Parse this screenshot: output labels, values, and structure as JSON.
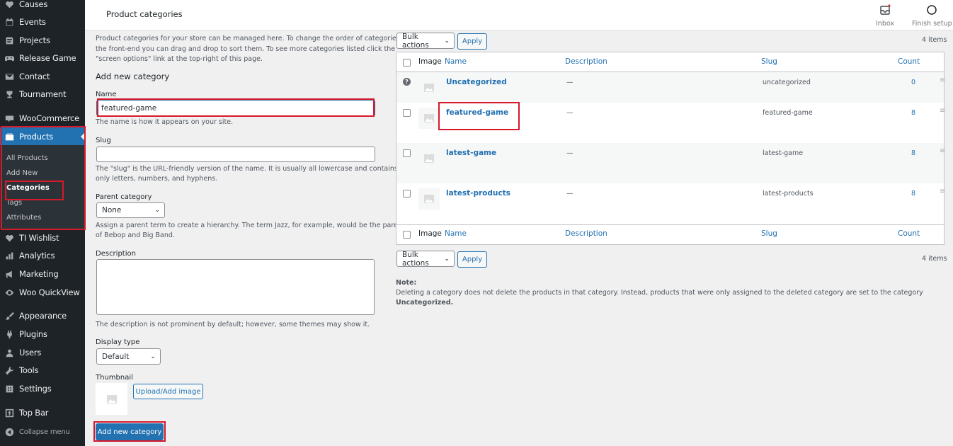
{
  "sidebar": {
    "items": [
      {
        "label": "Causes",
        "icon": "heart-icon"
      },
      {
        "label": "Events",
        "icon": "calendar-icon"
      },
      {
        "label": "Projects",
        "icon": "projects-icon"
      },
      {
        "label": "Release Game",
        "icon": "gamepad-icon"
      },
      {
        "label": "Contact",
        "icon": "mail-icon"
      },
      {
        "label": "Tournament",
        "icon": "tournament-icon"
      },
      {
        "label": "WooCommerce",
        "icon": "woocommerce-icon"
      },
      {
        "label": "Products",
        "icon": "products-icon"
      },
      {
        "label": "TI Wishlist",
        "icon": "wishlist-icon"
      },
      {
        "label": "Analytics",
        "icon": "bar-chart-icon"
      },
      {
        "label": "Marketing",
        "icon": "megaphone-icon"
      },
      {
        "label": "Woo QuickView",
        "icon": "eye-icon"
      },
      {
        "label": "Appearance",
        "icon": "brush-icon"
      },
      {
        "label": "Plugins",
        "icon": "plug-icon"
      },
      {
        "label": "Users",
        "icon": "user-icon"
      },
      {
        "label": "Tools",
        "icon": "wrench-icon"
      },
      {
        "label": "Settings",
        "icon": "settings-icon"
      },
      {
        "label": "Top Bar",
        "icon": "top-bar-icon"
      }
    ],
    "submenu": [
      "All Products",
      "Add New",
      "Categories",
      "Tags",
      "Attributes"
    ],
    "collapse_label": "Collapse menu"
  },
  "header": {
    "title": "Product categories",
    "inbox_label": "Inbox",
    "finish_setup_label": "Finish setup"
  },
  "form": {
    "intro": [
      "Product categories for your store can be managed here. To change the order of categories on",
      "the front-end you can drag and drop to sort them. To see more categories listed click the",
      "\"screen options\" link at the top-right of this page."
    ],
    "heading": "Add new category",
    "name_label": "Name",
    "name_value": "featured-game",
    "name_help": "The name is how it appears on your site.",
    "slug_label": "Slug",
    "slug_value": "",
    "slug_help": [
      "The \"slug\" is the URL-friendly version of the name. It is usually all lowercase and contains",
      "only letters, numbers, and hyphens."
    ],
    "parent_label": "Parent category",
    "parent_value": "None",
    "parent_help": [
      "Assign a parent term to create a hierarchy. The term Jazz, for example, would be the parent",
      "of Bebop and Big Band."
    ],
    "description_label": "Description",
    "description_help": "The description is not prominent by default; however, some themes may show it.",
    "display_type_label": "Display type",
    "display_type_value": "Default",
    "thumbnail_label": "Thumbnail",
    "upload_button": "Upload/Add image",
    "submit_button": "Add new category"
  },
  "table": {
    "bulk_actions": "Bulk actions",
    "apply": "Apply",
    "items_count": "4 items",
    "columns": [
      "Image",
      "Name",
      "Description",
      "Slug",
      "Count"
    ],
    "rows": [
      {
        "name": "Uncategorized",
        "description": "—",
        "slug": "uncategorized",
        "count": "0"
      },
      {
        "name": "featured-game",
        "description": "—",
        "slug": "featured-game",
        "count": "8"
      },
      {
        "name": "latest-game",
        "description": "—",
        "slug": "latest-game",
        "count": "8"
      },
      {
        "name": "latest-products",
        "description": "—",
        "slug": "latest-products",
        "count": "8"
      }
    ],
    "note_label": "Note:",
    "note_text": "Deleting a category does not delete the products in that category. Instead, products that were only assigned to the deleted category are set to the category",
    "note_bold": "Uncategorized."
  },
  "colors": {
    "sidebar_bg": "#1d2327",
    "accent": "#2271b1",
    "highlight_box": "#d7192a"
  }
}
